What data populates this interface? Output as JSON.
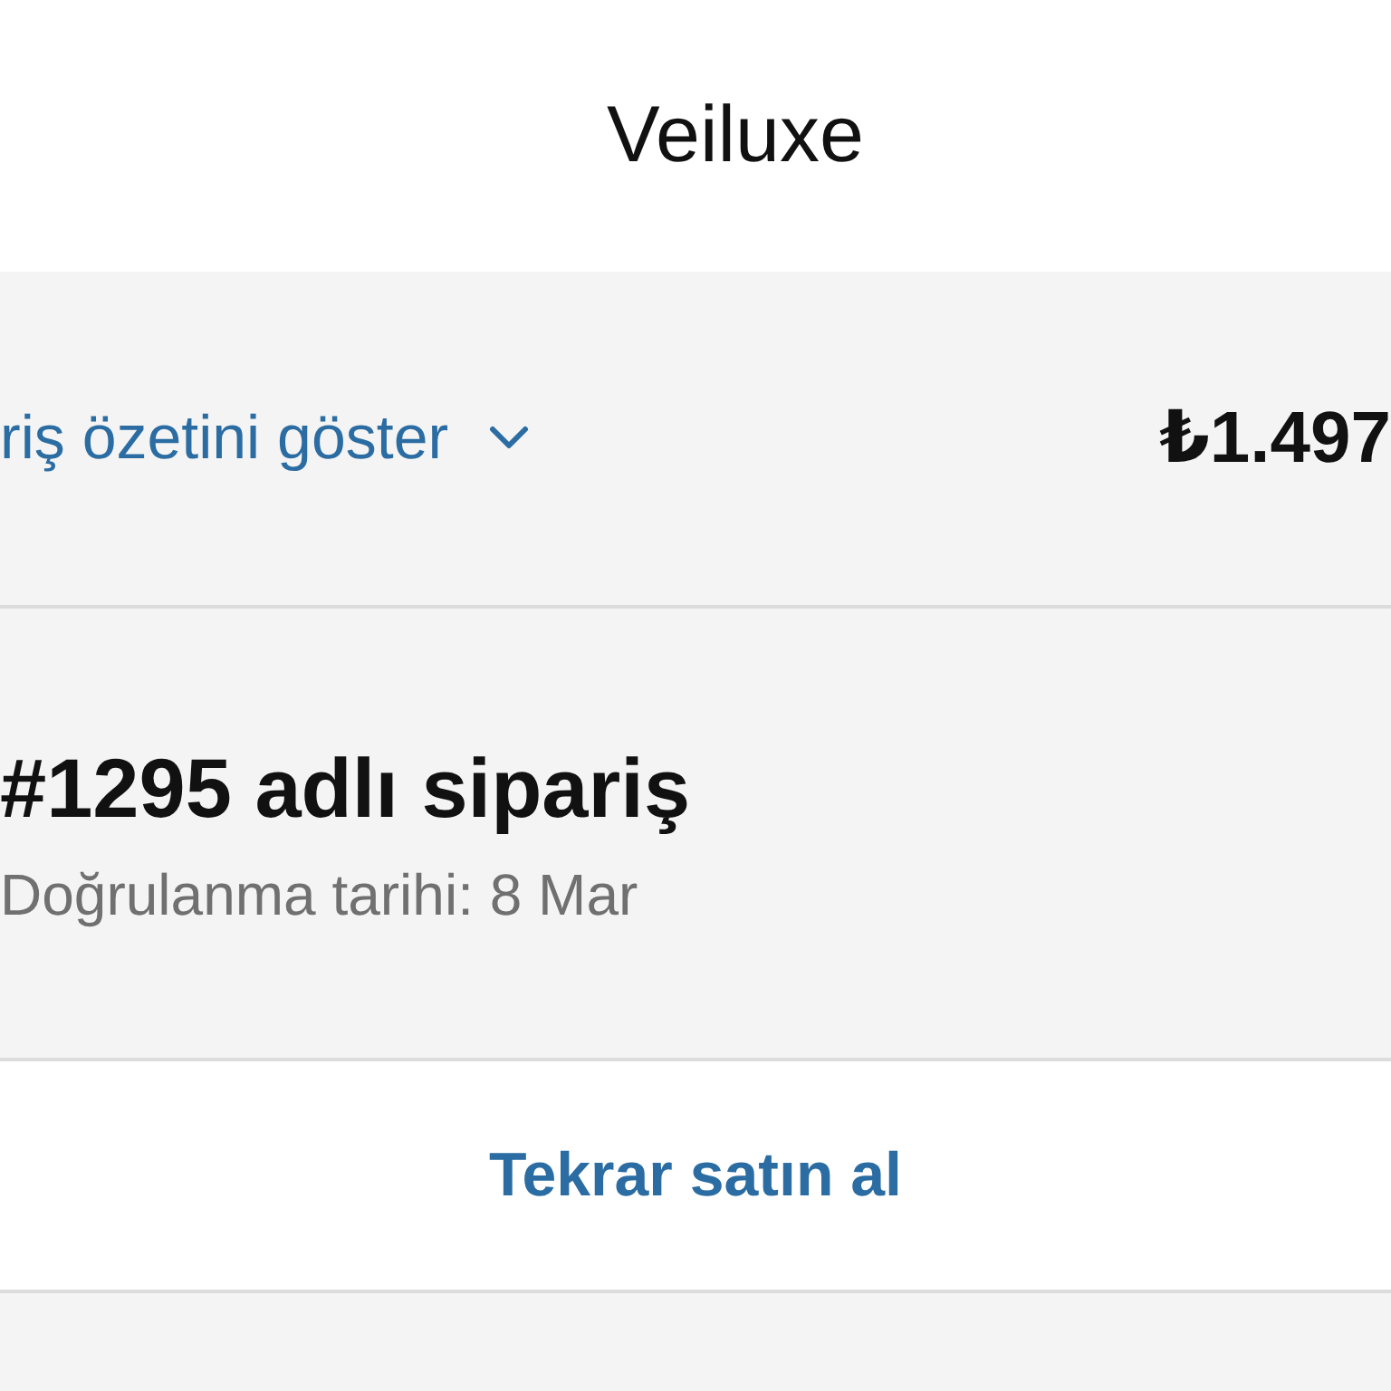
{
  "header": {
    "title": "Veiluxe"
  },
  "summary": {
    "toggle_label": "riş özetini göster",
    "expanded": false,
    "total": "₺1.497"
  },
  "order": {
    "title": "#1295 adlı sipariş",
    "confirmed": "Doğrulanma tarihi: 8 Mar"
  },
  "actions": [
    {
      "label": "Tekrar satın al"
    }
  ]
}
